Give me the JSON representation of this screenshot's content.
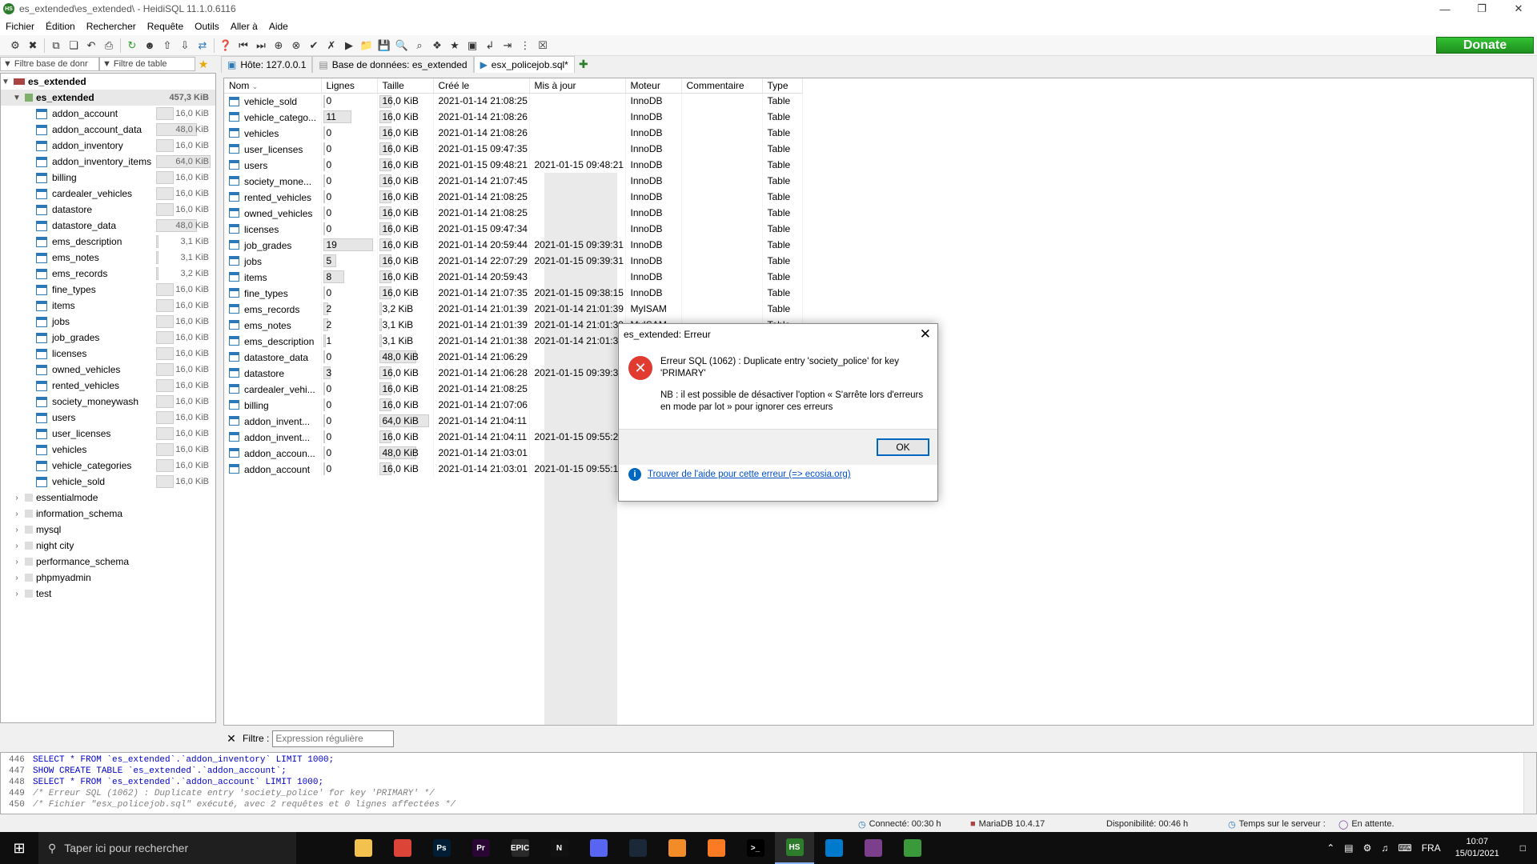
{
  "window": {
    "title": "es_extended\\es_extended\\ - HeidiSQL 11.1.0.6116"
  },
  "menu": [
    "Fichier",
    "Édition",
    "Rechercher",
    "Requête",
    "Outils",
    "Aller à",
    "Aide"
  ],
  "donate": "Donate",
  "filters": {
    "db_placeholder": "Filtre base de donr",
    "table_placeholder": "Filtre de table"
  },
  "tabs": [
    {
      "label": "Hôte: 127.0.0.1"
    },
    {
      "label": "Base de données: es_extended"
    },
    {
      "label": "esx_policejob.sql*"
    }
  ],
  "tree": {
    "root": "es_extended",
    "db": {
      "name": "es_extended",
      "size": "457,3 KiB"
    },
    "tables": [
      {
        "name": "addon_account",
        "size": "16,0 KiB",
        "frac": 0.33
      },
      {
        "name": "addon_account_data",
        "size": "48,0 KiB",
        "frac": 0.75
      },
      {
        "name": "addon_inventory",
        "size": "16,0 KiB",
        "frac": 0.33
      },
      {
        "name": "addon_inventory_items",
        "size": "64,0 KiB",
        "frac": 1.0
      },
      {
        "name": "billing",
        "size": "16,0 KiB",
        "frac": 0.33
      },
      {
        "name": "cardealer_vehicles",
        "size": "16,0 KiB",
        "frac": 0.33
      },
      {
        "name": "datastore",
        "size": "16,0 KiB",
        "frac": 0.33
      },
      {
        "name": "datastore_data",
        "size": "48,0 KiB",
        "frac": 0.75
      },
      {
        "name": "ems_description",
        "size": "3,1 KiB",
        "frac": 0.05
      },
      {
        "name": "ems_notes",
        "size": "3,1 KiB",
        "frac": 0.05
      },
      {
        "name": "ems_records",
        "size": "3,2 KiB",
        "frac": 0.05
      },
      {
        "name": "fine_types",
        "size": "16,0 KiB",
        "frac": 0.33
      },
      {
        "name": "items",
        "size": "16,0 KiB",
        "frac": 0.33
      },
      {
        "name": "jobs",
        "size": "16,0 KiB",
        "frac": 0.33
      },
      {
        "name": "job_grades",
        "size": "16,0 KiB",
        "frac": 0.33
      },
      {
        "name": "licenses",
        "size": "16,0 KiB",
        "frac": 0.33
      },
      {
        "name": "owned_vehicles",
        "size": "16,0 KiB",
        "frac": 0.33
      },
      {
        "name": "rented_vehicles",
        "size": "16,0 KiB",
        "frac": 0.33
      },
      {
        "name": "society_moneywash",
        "size": "16,0 KiB",
        "frac": 0.33
      },
      {
        "name": "users",
        "size": "16,0 KiB",
        "frac": 0.33
      },
      {
        "name": "user_licenses",
        "size": "16,0 KiB",
        "frac": 0.33
      },
      {
        "name": "vehicles",
        "size": "16,0 KiB",
        "frac": 0.33
      },
      {
        "name": "vehicle_categories",
        "size": "16,0 KiB",
        "frac": 0.33
      },
      {
        "name": "vehicle_sold",
        "size": "16,0 KiB",
        "frac": 0.33
      }
    ],
    "other_dbs": [
      "essentialmode",
      "information_schema",
      "mysql",
      "night city",
      "performance_schema",
      "phpmyadmin",
      "test"
    ]
  },
  "grid": {
    "columns": [
      "Nom",
      "Lignes",
      "Taille",
      "Créé le",
      "Mis à jour",
      "Moteur",
      "Commentaire",
      "Type"
    ],
    "rows": [
      {
        "name": "vehicle_sold",
        "rows": "0",
        "rows_frac": 0,
        "size": "16,0 KiB",
        "size_frac": 0.25,
        "created": "2021-01-14 21:08:25",
        "updated": "",
        "engine": "InnoDB",
        "comment": "",
        "type": "Table"
      },
      {
        "name": "vehicle_catego...",
        "rows": "11",
        "rows_frac": 0.58,
        "size": "16,0 KiB",
        "size_frac": 0.25,
        "created": "2021-01-14 21:08:26",
        "updated": "",
        "engine": "InnoDB",
        "comment": "",
        "type": "Table"
      },
      {
        "name": "vehicles",
        "rows": "0",
        "rows_frac": 0,
        "size": "16,0 KiB",
        "size_frac": 0.25,
        "created": "2021-01-14 21:08:26",
        "updated": "",
        "engine": "InnoDB",
        "comment": "",
        "type": "Table"
      },
      {
        "name": "user_licenses",
        "rows": "0",
        "rows_frac": 0,
        "size": "16,0 KiB",
        "size_frac": 0.25,
        "created": "2021-01-15 09:47:35",
        "updated": "",
        "engine": "InnoDB",
        "comment": "",
        "type": "Table"
      },
      {
        "name": "users",
        "rows": "0",
        "rows_frac": 0,
        "size": "16,0 KiB",
        "size_frac": 0.25,
        "created": "2021-01-15 09:48:21",
        "updated": "2021-01-15 09:48:21",
        "engine": "InnoDB",
        "comment": "",
        "type": "Table"
      },
      {
        "name": "society_mone...",
        "rows": "0",
        "rows_frac": 0,
        "size": "16,0 KiB",
        "size_frac": 0.25,
        "created": "2021-01-14 21:07:45",
        "updated": "",
        "engine": "InnoDB",
        "comment": "",
        "type": "Table"
      },
      {
        "name": "rented_vehicles",
        "rows": "0",
        "rows_frac": 0,
        "size": "16,0 KiB",
        "size_frac": 0.25,
        "created": "2021-01-14 21:08:25",
        "updated": "",
        "engine": "InnoDB",
        "comment": "",
        "type": "Table"
      },
      {
        "name": "owned_vehicles",
        "rows": "0",
        "rows_frac": 0,
        "size": "16,0 KiB",
        "size_frac": 0.25,
        "created": "2021-01-14 21:08:25",
        "updated": "",
        "engine": "InnoDB",
        "comment": "",
        "type": "Table"
      },
      {
        "name": "licenses",
        "rows": "0",
        "rows_frac": 0,
        "size": "16,0 KiB",
        "size_frac": 0.25,
        "created": "2021-01-15 09:47:34",
        "updated": "",
        "engine": "InnoDB",
        "comment": "",
        "type": "Table"
      },
      {
        "name": "job_grades",
        "rows": "19",
        "rows_frac": 1.0,
        "size": "16,0 KiB",
        "size_frac": 0.25,
        "created": "2021-01-14 20:59:44",
        "updated": "2021-01-15 09:39:31",
        "engine": "InnoDB",
        "comment": "",
        "type": "Table"
      },
      {
        "name": "jobs",
        "rows": "5",
        "rows_frac": 0.26,
        "size": "16,0 KiB",
        "size_frac": 0.25,
        "created": "2021-01-14 22:07:29",
        "updated": "2021-01-15 09:39:31",
        "engine": "InnoDB",
        "comment": "",
        "type": "Table"
      },
      {
        "name": "items",
        "rows": "8",
        "rows_frac": 0.42,
        "size": "16,0 KiB",
        "size_frac": 0.25,
        "created": "2021-01-14 20:59:43",
        "updated": "",
        "engine": "InnoDB",
        "comment": "",
        "type": "Table"
      },
      {
        "name": "fine_types",
        "rows": "0",
        "rows_frac": 0,
        "size": "16,0 KiB",
        "size_frac": 0.25,
        "created": "2021-01-14 21:07:35",
        "updated": "2021-01-15 09:38:15",
        "engine": "InnoDB",
        "comment": "",
        "type": "Table"
      },
      {
        "name": "ems_records",
        "rows": "2",
        "rows_frac": 0.1,
        "size": "3,2 KiB",
        "size_frac": 0.05,
        "created": "2021-01-14 21:01:39",
        "updated": "2021-01-14 21:01:39",
        "engine": "MyISAM",
        "comment": "",
        "type": "Table"
      },
      {
        "name": "ems_notes",
        "rows": "2",
        "rows_frac": 0.1,
        "size": "3,1 KiB",
        "size_frac": 0.05,
        "created": "2021-01-14 21:01:39",
        "updated": "2021-01-14 21:01:39",
        "engine": "MyISAM",
        "comment": "",
        "type": "Table"
      },
      {
        "name": "ems_description",
        "rows": "1",
        "rows_frac": 0.05,
        "size": "3,1 KiB",
        "size_frac": 0.05,
        "created": "2021-01-14 21:01:38",
        "updated": "2021-01-14 21:01:39",
        "engine": "",
        "comment": "",
        "type": ""
      },
      {
        "name": "datastore_data",
        "rows": "0",
        "rows_frac": 0,
        "size": "48,0 KiB",
        "size_frac": 0.75,
        "created": "2021-01-14 21:06:29",
        "updated": "",
        "engine": "",
        "comment": "",
        "type": ""
      },
      {
        "name": "datastore",
        "rows": "3",
        "rows_frac": 0.16,
        "size": "16,0 KiB",
        "size_frac": 0.25,
        "created": "2021-01-14 21:06:28",
        "updated": "2021-01-15 09:39:31",
        "engine": "",
        "comment": "",
        "type": ""
      },
      {
        "name": "cardealer_vehi...",
        "rows": "0",
        "rows_frac": 0,
        "size": "16,0 KiB",
        "size_frac": 0.25,
        "created": "2021-01-14 21:08:25",
        "updated": "",
        "engine": "",
        "comment": "",
        "type": ""
      },
      {
        "name": "billing",
        "rows": "0",
        "rows_frac": 0,
        "size": "16,0 KiB",
        "size_frac": 0.25,
        "created": "2021-01-14 21:07:06",
        "updated": "",
        "engine": "",
        "comment": "",
        "type": ""
      },
      {
        "name": "addon_invent...",
        "rows": "0",
        "rows_frac": 0,
        "size": "64,0 KiB",
        "size_frac": 1.0,
        "created": "2021-01-14 21:04:11",
        "updated": "",
        "engine": "",
        "comment": "",
        "type": ""
      },
      {
        "name": "addon_invent...",
        "rows": "0",
        "rows_frac": 0,
        "size": "16,0 KiB",
        "size_frac": 0.25,
        "created": "2021-01-14 21:04:11",
        "updated": "2021-01-15 09:55:25",
        "engine": "",
        "comment": "",
        "type": ""
      },
      {
        "name": "addon_accoun...",
        "rows": "0",
        "rows_frac": 0,
        "size": "48,0 KiB",
        "size_frac": 0.75,
        "created": "2021-01-14 21:03:01",
        "updated": "",
        "engine": "",
        "comment": "",
        "type": ""
      },
      {
        "name": "addon_account",
        "rows": "0",
        "rows_frac": 0,
        "size": "16,0 KiB",
        "size_frac": 0.25,
        "created": "2021-01-14 21:03:01",
        "updated": "2021-01-15 09:55:15",
        "engine": "",
        "comment": "",
        "type": ""
      }
    ]
  },
  "filterrow": {
    "label": "Filtre :",
    "placeholder": "Expression régulière"
  },
  "sqllog": [
    {
      "no": "446",
      "code": "SELECT * FROM `es_extended`.`addon_inventory` LIMIT 1000;",
      "comment": false
    },
    {
      "no": "447",
      "code": "SHOW CREATE TABLE `es_extended`.`addon_account`;",
      "comment": false
    },
    {
      "no": "448",
      "code": "SELECT * FROM `es_extended`.`addon_account` LIMIT 1000;",
      "comment": false
    },
    {
      "no": "449",
      "code": "/* Erreur SQL (1062) : Duplicate entry 'society_police' for key 'PRIMARY' */",
      "comment": true
    },
    {
      "no": "450",
      "code": "/* Fichier \"esx_policejob.sql\" exécuté, avec 2 requêtes et 0 lignes affectées */",
      "comment": true
    }
  ],
  "status": {
    "connected": "Connecté: 00:30 h",
    "server": "MariaDB 10.4.17",
    "uptime": "Disponibilité: 00:46 h",
    "servertime": "Temps sur le serveur : ",
    "idle": "En attente."
  },
  "dialog": {
    "title": "es_extended: Erreur",
    "message": "Erreur SQL (1062) : Duplicate entry 'society_police' for key 'PRIMARY'",
    "note": "NB : il est possible de désactiver l'option « S'arrête lors d'erreurs en mode par lot » pour ignorer ces erreurs",
    "ok": "OK",
    "help": "Trouver de l'aide pour cette erreur (=> ecosia.org)"
  },
  "taskbar": {
    "search_placeholder": "Taper ici pour rechercher",
    "apps": [
      {
        "icon": "task-view-icon",
        "label": "",
        "color": "#0e0e0e"
      },
      {
        "icon": "file-explorer-icon",
        "label": "",
        "color": "#f2c14e"
      },
      {
        "icon": "chrome-icon",
        "label": "",
        "color": "#db4437"
      },
      {
        "icon": "photoshop-icon",
        "label": "Ps",
        "color": "#001e36"
      },
      {
        "icon": "premiere-icon",
        "label": "Pr",
        "color": "#2a0634"
      },
      {
        "icon": "epic-games-icon",
        "label": "EPIC",
        "color": "#2a2a2a"
      },
      {
        "icon": "netflix-icon",
        "label": "N",
        "color": "#111"
      },
      {
        "icon": "discord-icon",
        "label": "",
        "color": "#5865f2"
      },
      {
        "icon": "steam-icon",
        "label": "",
        "color": "#1b2838"
      },
      {
        "icon": "artstation-icon",
        "label": "",
        "color": "#f28c28"
      },
      {
        "icon": "xampp-icon",
        "label": "",
        "color": "#fb7a24"
      },
      {
        "icon": "terminal-icon",
        "label": ">_",
        "color": "#000"
      },
      {
        "icon": "heidisql-icon",
        "label": "HS",
        "color": "#2d7d2d"
      },
      {
        "icon": "vscode-icon",
        "label": "",
        "color": "#007acc"
      },
      {
        "icon": "winrar-icon",
        "label": "",
        "color": "#7b3f8c"
      },
      {
        "icon": "notepad-icon",
        "label": "",
        "color": "#3a9a3a"
      }
    ],
    "lang": "FRA",
    "time": "10:07",
    "date": "15/01/2021"
  },
  "colors": {
    "accent": "#2b79b8",
    "donate": "#2d9e2d",
    "error": "#e03a31",
    "link": "#0050c8"
  }
}
